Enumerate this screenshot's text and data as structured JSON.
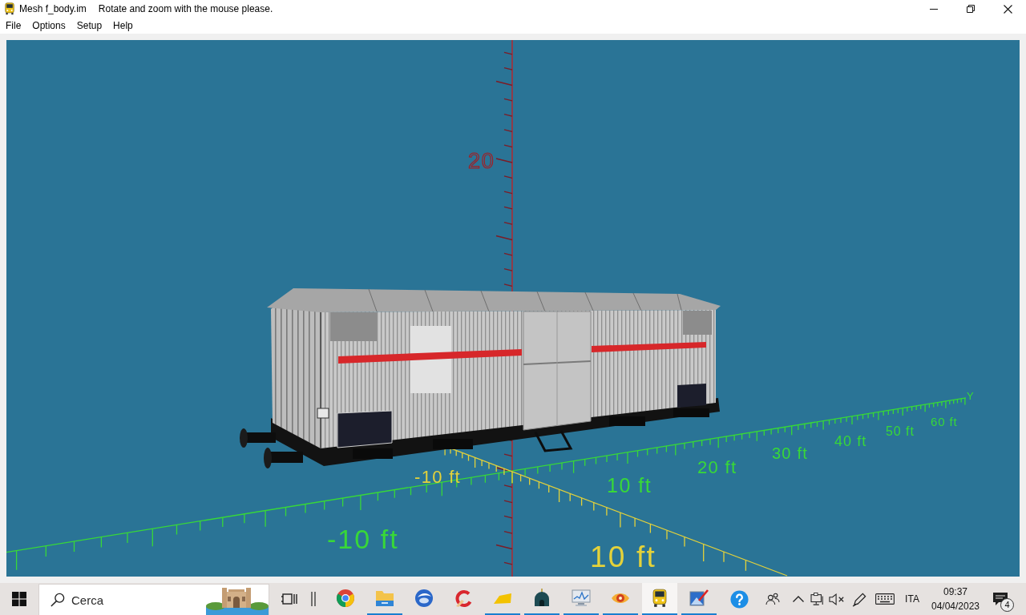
{
  "window": {
    "title": "Mesh f_body.im",
    "hint": "Rotate and zoom with the mouse please."
  },
  "menu": [
    "File",
    "Options",
    "Setup",
    "Help"
  ],
  "viewport": {
    "axes": [
      {
        "kind": "vertical",
        "labels": [
          "20"
        ]
      },
      {
        "kind": "lateral",
        "name": "Y",
        "labels": [
          "-10 ft",
          "10 ft",
          "20 ft",
          "30 ft",
          "40 ft",
          "50 ft",
          "60 ft"
        ]
      },
      {
        "kind": "depth",
        "labels": [
          "-10 ft",
          "10 ft"
        ]
      }
    ]
  },
  "taskbar": {
    "search": {
      "placeholder": "Cerca"
    },
    "apps": [
      {
        "kind": "ring",
        "running": false,
        "selected": false
      },
      {
        "kind": "folder",
        "running": true,
        "selected": false
      },
      {
        "kind": "globe",
        "running": false,
        "selected": false
      },
      {
        "kind": "swirl",
        "running": false,
        "selected": false
      },
      {
        "kind": "wedge",
        "running": true,
        "selected": false
      },
      {
        "kind": "dome",
        "running": true,
        "selected": false
      },
      {
        "kind": "monitor",
        "running": true,
        "selected": false
      },
      {
        "kind": "eye",
        "running": true,
        "selected": false
      },
      {
        "kind": "train",
        "running": true,
        "selected": true
      },
      {
        "kind": "picture",
        "running": true,
        "selected": false
      }
    ],
    "tray": {
      "language": "ITA",
      "time": "09:37",
      "date": "04/04/2023",
      "notifications": "4"
    }
  }
}
